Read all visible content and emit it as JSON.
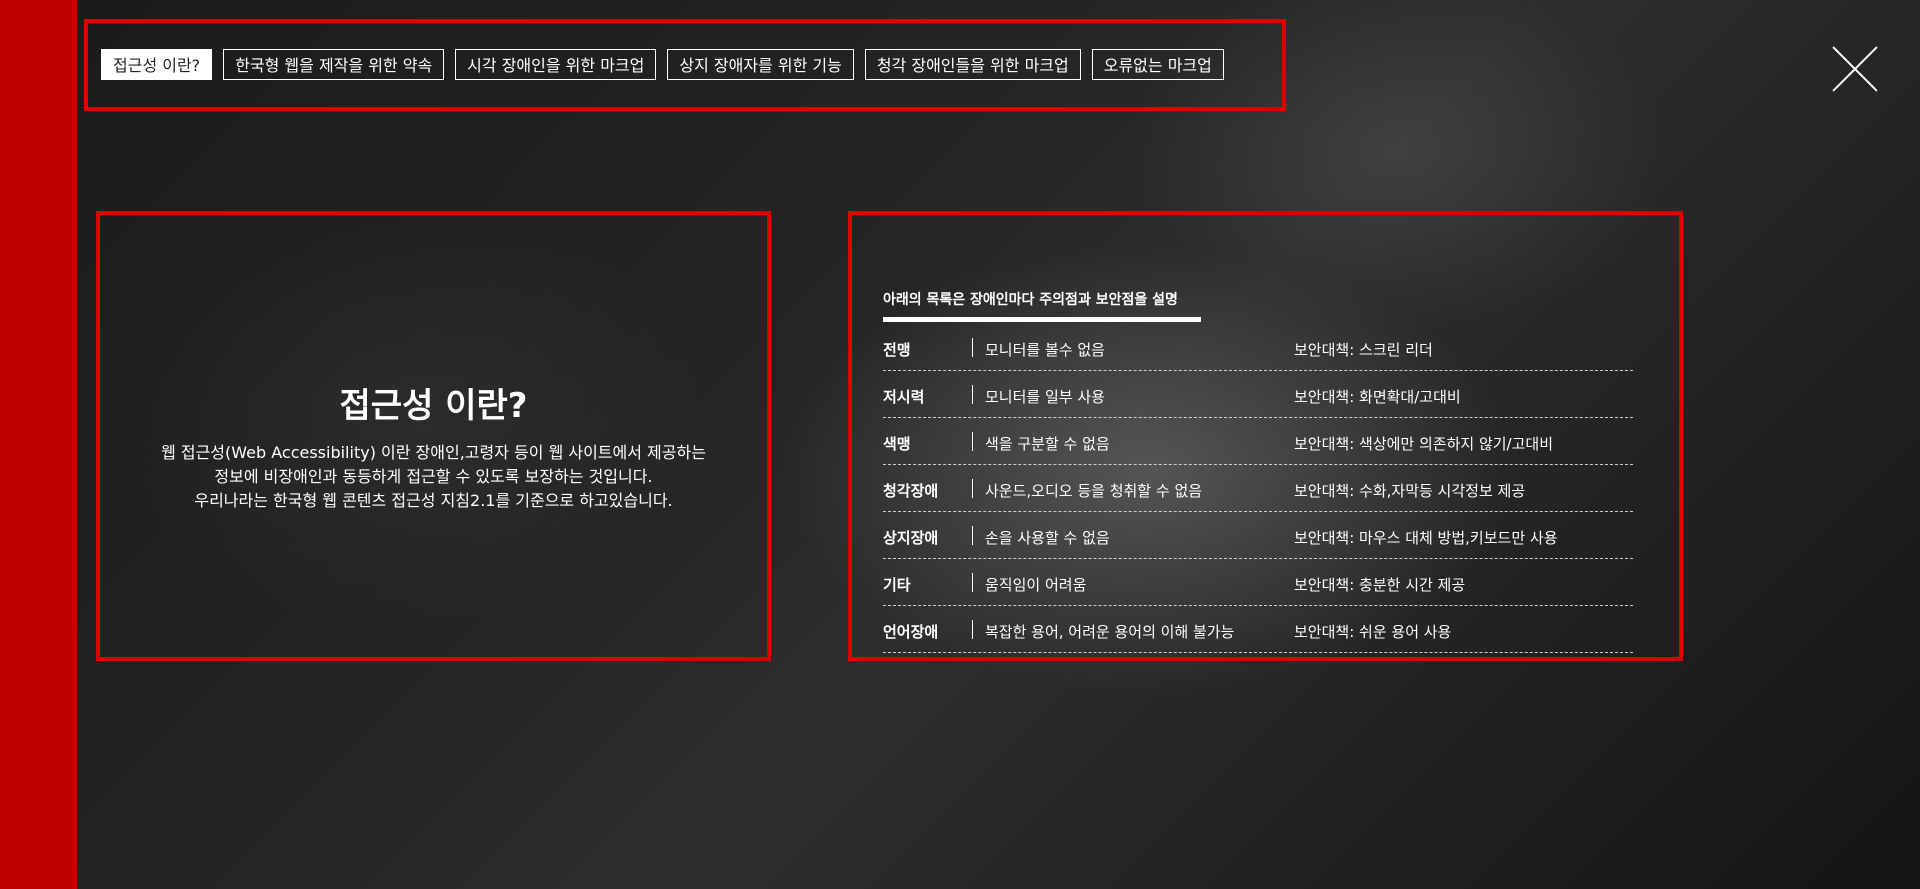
{
  "tabs": [
    {
      "label": "접근성 이란?",
      "active": true
    },
    {
      "label": "한국형 웹을 제작을 위한 약속",
      "active": false
    },
    {
      "label": "시각 장애인을 위한 마크업",
      "active": false
    },
    {
      "label": "상지 장애자를 위한 기능",
      "active": false
    },
    {
      "label": "청각 장애인들을 위한 마크업",
      "active": false
    },
    {
      "label": "오류없는 마크업",
      "active": false
    }
  ],
  "intro": {
    "title": "접근성 이란?",
    "desc_line1": "웹 접근성(Web Accessibility) 이란 장애인,고령자 등이 웹 사이트에서 제공하는",
    "desc_line2": "정보에 비장애인과 동등하게 접근할 수 있도록 보장하는 것입니다.",
    "desc_line3": "우리나라는 한국형 웹 콘텐츠 접근성 지침2.1를 기준으로 하고있습니다."
  },
  "list": {
    "heading": "아래의 목록은 장애인마다 주의점과 보안점을 설명",
    "rows": [
      {
        "name": "전맹",
        "problem": "모니터를 볼수 없음",
        "solution": "보안대책: 스크린 리더"
      },
      {
        "name": "저시력",
        "problem": "모니터를 일부 사용",
        "solution": "보안대책: 화면확대/고대비"
      },
      {
        "name": "색맹",
        "problem": "색을 구분할 수 없음",
        "solution": "보안대책: 색상에만 의존하지 않기/고대비"
      },
      {
        "name": "청각장애",
        "problem": "사운드,오디오 등을 청취할 수 없음",
        "solution": "보안대책: 수화,자막등 시각정보 제공"
      },
      {
        "name": "상지장애",
        "problem": "손을 사용할 수 없음",
        "solution": "보안대책: 마우스 대체 방법,키보드만 사용"
      },
      {
        "name": "기타",
        "problem": "움직임이 어려움",
        "solution": "보안대책: 충분한 시간 제공"
      },
      {
        "name": "언어장애",
        "problem": "복잡한 용어, 어려운 용어의 이해 불가능",
        "solution": "보안대책: 쉬운 용어 사용"
      }
    ]
  },
  "colors": {
    "accent": "#e00000",
    "sidebar": "#c10000"
  },
  "icons": {
    "close": "close-icon"
  }
}
